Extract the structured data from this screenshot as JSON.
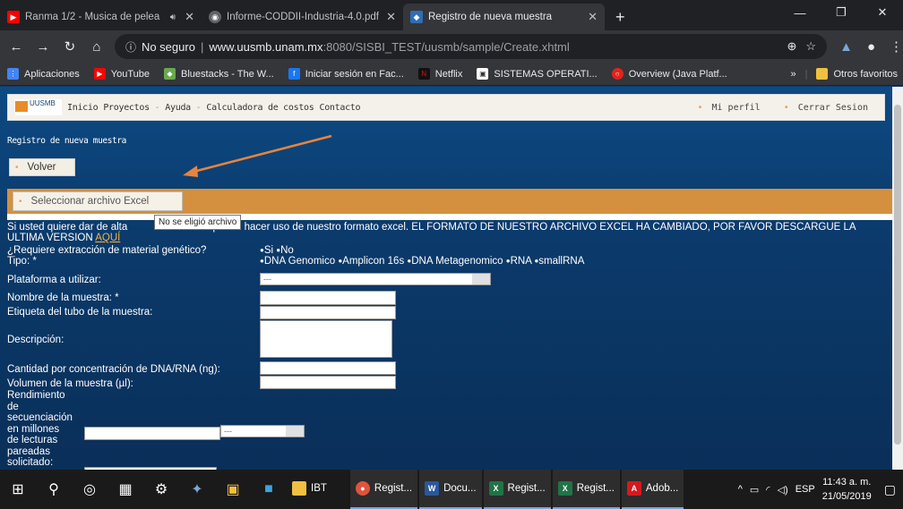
{
  "browser": {
    "tabs": [
      {
        "title": "Ranma 1/2 - Musica de pelea",
        "icon": "youtube-icon",
        "audio": true
      },
      {
        "title": "Informe-CODDII-Industria-4.0.pdf",
        "icon": "globe-icon"
      },
      {
        "title": "Registro de nueva muestra",
        "icon": "site-favicon",
        "active": true
      }
    ],
    "newtab": "+",
    "url": {
      "security": "No seguro",
      "host": "www.uusmb.unam.mx",
      "path": ":8080/SISBI_TEST/uusmb/sample/Create.xhtml"
    },
    "bookmarks": [
      {
        "label": "Aplicaciones",
        "icon": "apps-icon"
      },
      {
        "label": "YouTube",
        "icon": "youtube-icon"
      },
      {
        "label": "Bluestacks - The W...",
        "icon": "bluestacks-icon"
      },
      {
        "label": "Iniciar sesión en Fac...",
        "icon": "facebook-icon"
      },
      {
        "label": "Netflix",
        "icon": "netflix-icon"
      },
      {
        "label": "SISTEMAS OPERATI...",
        "icon": "bookmark-icon"
      },
      {
        "label": "Overview (Java Platf...",
        "icon": "oracle-icon"
      }
    ],
    "bookmarks_more": "»",
    "other_favorites": "Otros favoritos"
  },
  "site": {
    "logo_text": "UUSMB",
    "nav": [
      "Inicio",
      "Proyectos",
      "Ayuda",
      "Calculadora de costos",
      "Contacto"
    ],
    "profile": "Mi perfil",
    "logout": "Cerrar Sesion"
  },
  "form": {
    "breadcrumb": "Registro de nueva muestra",
    "back": "Volver",
    "excel": "Seleccionar archivo Excel",
    "tooltip": "No se eligió archivo",
    "notice_a": "Si usted quiere dar de alta",
    "notice_b": "s puede hacer uso de nuestro formato excel. EL FORMATO DE NUESTRO ARCHIVO EXCEL HA CAMBIADO, POR FAVOR DESCARGUE LA ULTIMA VERSION ",
    "notice_link": "AQUÍ",
    "extraction_label": "¿Requiere extracción de material genético?",
    "extraction_opts": [
      "Si",
      "No"
    ],
    "type_label": "Tipo: *",
    "type_opts": [
      "DNA Genomico",
      "Amplicon 16s",
      "DNA Metagenomico",
      "RNA",
      "smallRNA"
    ],
    "platform_label": "Plataforma a utilizar:",
    "platform_value": "---",
    "name_label": "Nombre de la muestra: *",
    "tube_label": "Etiqueta del tubo de la muestra:",
    "desc_label": "Descripción:",
    "conc_label": "Cantidad por concentración de DNA/RNA (ng):",
    "vol_label": "Volumen de la muestra (µl):",
    "yield_label": [
      "Rendimiento",
      "de",
      "secuenciación",
      "en millones",
      "de lecturas",
      "pareadas",
      "solicitado:"
    ],
    "yield_select": "---"
  },
  "taskbar": {
    "apps": [
      {
        "label": "IBT",
        "icon": "folder-icon",
        "color": "#f0c040"
      },
      {
        "label": "Regist...",
        "icon": "chrome-icon",
        "color": "#e0533c"
      },
      {
        "label": "Docu...",
        "icon": "word-icon",
        "color": "#2b579a"
      },
      {
        "label": "Regist...",
        "icon": "excel-icon",
        "color": "#217346"
      },
      {
        "label": "Regist...",
        "icon": "excel-icon",
        "color": "#217346"
      },
      {
        "label": "Adob...",
        "icon": "acrobat-icon",
        "color": "#d4191e"
      }
    ],
    "lang": "ESP",
    "time": "11:43 a. m.",
    "date": "21/05/2019"
  }
}
